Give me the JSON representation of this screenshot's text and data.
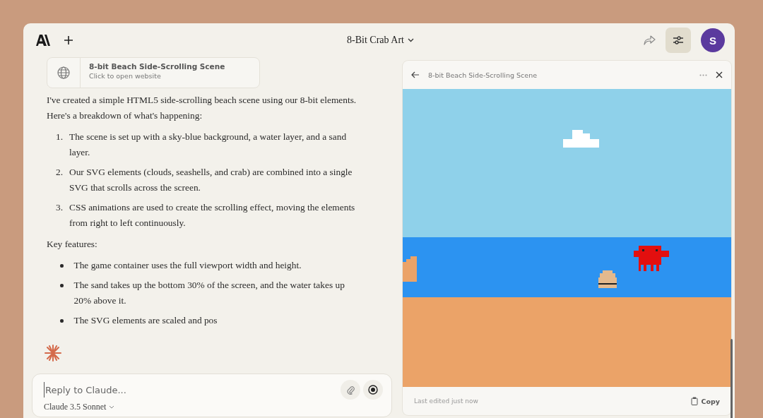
{
  "header": {
    "title": "8-Bit Crab Art",
    "avatar": "S"
  },
  "chat": {
    "artifact_card": {
      "title": "8-bit Beach Side-Scrolling Scene",
      "subtitle": "Click to open website"
    },
    "intro": "I've created a simple HTML5 side-scrolling beach scene using our 8-bit elements. Here's a breakdown of what's happening:",
    "steps": [
      {
        "number": "1.",
        "text": "The scene is set up with a sky-blue background, a water layer, and a sand layer."
      },
      {
        "number": "2.",
        "text": "Our SVG elements (clouds, seashells, and crab) are combined into a single SVG that scrolls across the screen."
      },
      {
        "number": "3.",
        "text": "CSS animations are used to create the scrolling effect, moving the elements from right to left continuously."
      }
    ],
    "features_heading": "Key features:",
    "features": [
      "The game container uses the full viewport width and height.",
      "The sand takes up the bottom 30% of the screen, and the water takes up 20% above it.",
      "The SVG elements are scaled and pos"
    ]
  },
  "composer": {
    "placeholder": "Reply to Claude...",
    "model": "Claude 3.5 Sonnet"
  },
  "artifact": {
    "title": "8-bit Beach Side-Scrolling Scene",
    "footer": "Last edited just now",
    "copy": "Copy"
  }
}
